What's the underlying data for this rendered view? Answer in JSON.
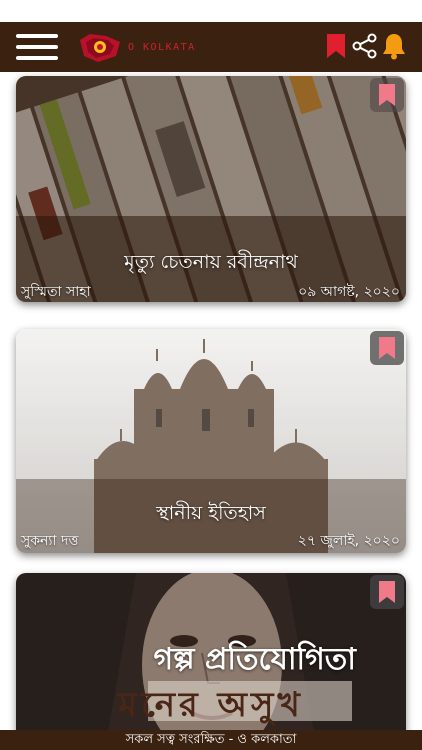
{
  "app": {
    "brand_text": "O KOLKATA"
  },
  "header": {
    "menu_icon": "hamburger-menu-icon",
    "bookmark_icon": "bookmark-icon",
    "share_icon": "share-icon",
    "bell_icon": "bell-icon",
    "bookmark_color": "#e0202e",
    "bell_color": "#f39c12"
  },
  "articles": [
    {
      "title": "মৃত্যু চেতনায় রবীন্দ্রনাথ",
      "author": "সুস্মিতা সাহা",
      "date": "০৯ আগষ্ট, ২০২০",
      "image": "rolled-newspapers"
    },
    {
      "title": "স্থানীয় ইতিহাস",
      "author": "সুকন্যা দত্ত",
      "date": "২৭ জুলাই, ২০২০",
      "image": "temple-in-fog"
    },
    {
      "title": "গল্প প্রতিযোগিতা",
      "subtitle": "মনের অসুখ",
      "image": "woman-face-portrait"
    }
  ],
  "footer": {
    "text": "সকল সত্ব সংরক্ষিত - ও কলকাতা"
  },
  "colors": {
    "bar": "#3b2210",
    "accent": "#e0202e",
    "card_bookmark": "#f07a8a"
  }
}
